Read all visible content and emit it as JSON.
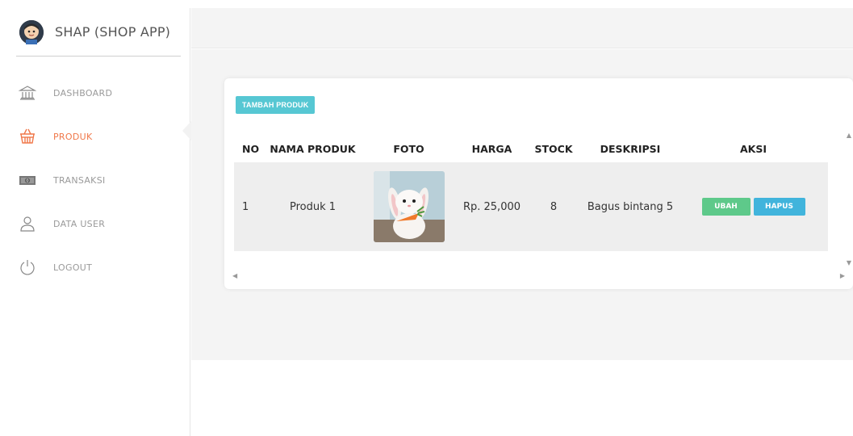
{
  "sidebar": {
    "brand": "SHAP (SHOP APP)",
    "items": [
      {
        "label": "DASHBOARD",
        "icon": "bank-icon"
      },
      {
        "label": "PRODUK",
        "icon": "basket-icon",
        "active": true
      },
      {
        "label": "TRANSAKSI",
        "icon": "money-icon"
      },
      {
        "label": "DATA USER",
        "icon": "user-icon"
      },
      {
        "label": "LOGOUT",
        "icon": "power-icon"
      }
    ]
  },
  "main": {
    "add_button": "TAMBAH PRODUK",
    "table": {
      "headers": [
        "NO",
        "NAMA PRODUK",
        "FOTO",
        "HARGA",
        "STOCK",
        "DESKRIPSI",
        "AKSI"
      ],
      "rows": [
        {
          "no": "1",
          "nama": "Produk 1",
          "foto": "bunny-plush-photo",
          "harga": "Rp. 25,000",
          "stock": "8",
          "deskripsi": "Bagus bintang 5",
          "ubah": "UBAH",
          "hapus": "HAPUS"
        }
      ]
    }
  },
  "colors": {
    "accent_active": "#f0784a",
    "add_button": "#56c7d3",
    "ubah_button": "#5ec98a",
    "hapus_button": "#41b4dc"
  }
}
